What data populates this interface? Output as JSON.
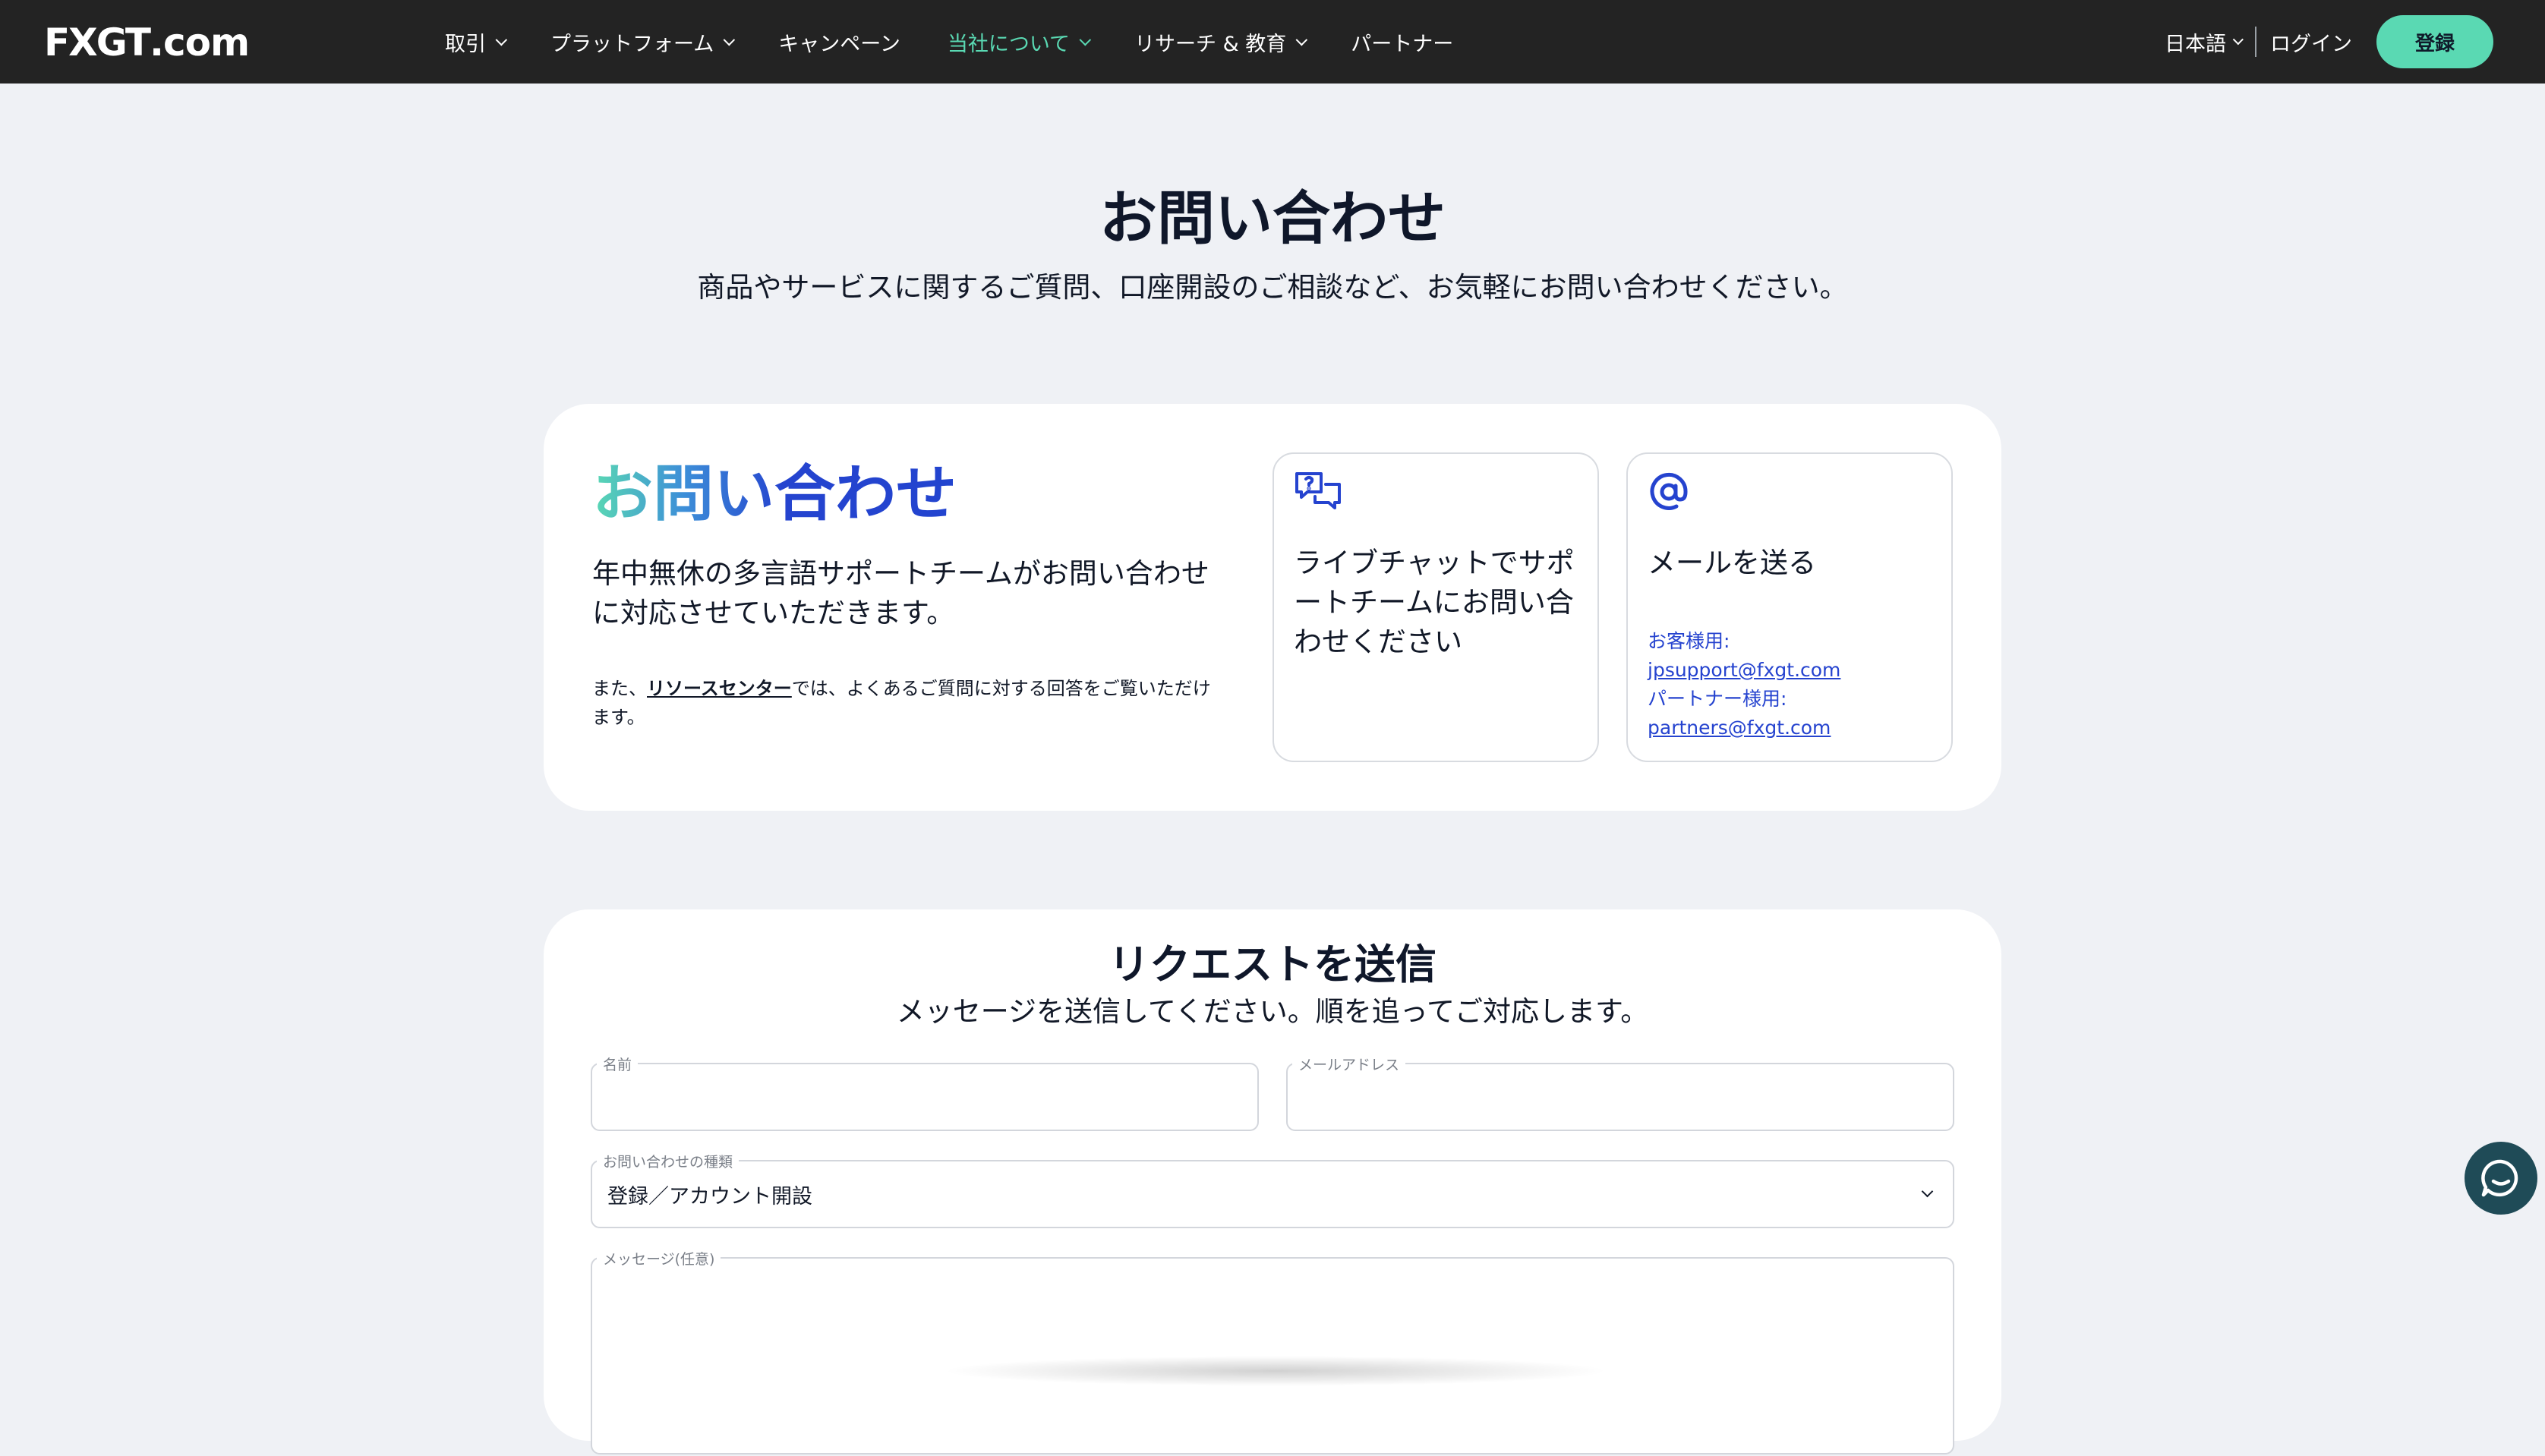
{
  "header": {
    "logo_fx": "FXGT",
    "logo_domain": ".com",
    "nav": [
      {
        "label": "取引",
        "dropdown": true,
        "active": false
      },
      {
        "label": "プラットフォーム",
        "dropdown": true,
        "active": false
      },
      {
        "label": "キャンペーン",
        "dropdown": false,
        "active": false
      },
      {
        "label": "当社について",
        "dropdown": true,
        "active": true
      },
      {
        "label": "リサーチ & 教育",
        "dropdown": true,
        "active": false
      },
      {
        "label": "パートナー",
        "dropdown": false,
        "active": false
      }
    ],
    "language": "日本語",
    "login": "ログイン",
    "register": "登録"
  },
  "page": {
    "title": "お問い合わせ",
    "subtitle": "商品やサービスに関するご質問、口座開設のご相談など、お気軽にお問い合わせください。"
  },
  "contact": {
    "heading": "お問い合わせ",
    "description": "年中無休の多言語サポートチームがお問い合わせに対応させていただきます。",
    "note_prefix": "また、",
    "note_link": "リソースセンター",
    "note_suffix": "では、よくあるご質問に対する回答をご覧いただけます。",
    "chat_title": "ライブチャットでサポートチームにお問い合わせください",
    "mail_title": "メールを送る",
    "customer_label": "お客様用:",
    "customer_email": "jpsupport@fxgt.com",
    "partner_label": "パートナー様用:",
    "partner_email": "partners@fxgt.com"
  },
  "form": {
    "title": "リクエストを送信",
    "subtitle": "メッセージを送信してください。順を追ってご対応します。",
    "name_label": "名前",
    "email_label": "メールアドレス",
    "type_label": "お問い合わせの種類",
    "type_value": "登録／アカウント開設",
    "message_label": "メッセージ(任意)"
  },
  "colors": {
    "nav_bg": "#232323",
    "accent": "#5ad9b3",
    "link_blue": "#2543cf",
    "page_bg": "#eff1f5"
  },
  "icons": {
    "chat_option": "chat-question-icon",
    "mail_option": "at-sign-icon",
    "fab": "chat-bubble-icon"
  }
}
